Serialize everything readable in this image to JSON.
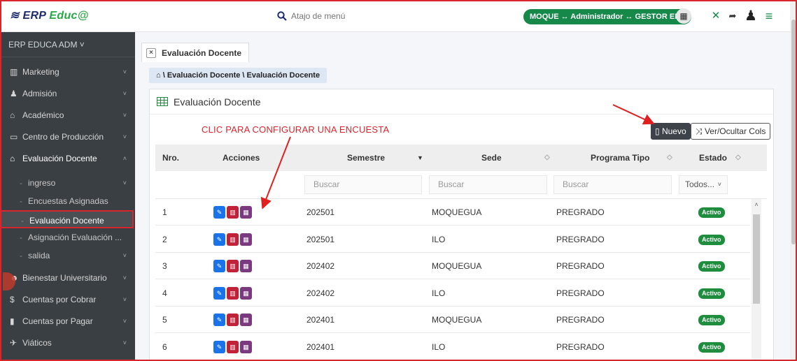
{
  "app": {
    "logo_prefix": "ERP ",
    "logo_suffix": "Educ@",
    "search_placeholder": "Atajo de menú",
    "user_info": "MOQUE ↔ Administrador ↔ GESTOR ERP",
    "brand_color": "#16894a"
  },
  "sidebar": {
    "header": "ERP EDUCA ADM ˅",
    "items": [
      {
        "label": "Marketing",
        "icon": "bar-chart-icon"
      },
      {
        "label": "Admisión",
        "icon": "user-icon"
      },
      {
        "label": "Académico",
        "icon": "graduation-cap-icon"
      },
      {
        "label": "Centro de Producción",
        "icon": "monitor-icon"
      },
      {
        "label": "Evaluación Docente",
        "icon": "graduation-cap-icon"
      }
    ],
    "subitems": [
      {
        "label": "ingreso"
      },
      {
        "label": "Encuestas Asignadas"
      },
      {
        "label": "Evaluación Docente"
      },
      {
        "label": "Asignación Evaluación ..."
      },
      {
        "label": "salida"
      }
    ],
    "items2": [
      {
        "label": "Bienestar Universitario",
        "icon": "users-icon"
      },
      {
        "label": "Cuentas por Cobrar",
        "icon": "dollar-icon"
      },
      {
        "label": "Cuentas por Pagar",
        "icon": "briefcase-icon"
      },
      {
        "label": "Viáticos",
        "icon": "plane-icon"
      }
    ]
  },
  "tabs": [
    {
      "label": "Evaluación Docente"
    }
  ],
  "breadcrumb": "\\ Evaluación Docente \\ Evaluación Docente",
  "card": {
    "title": "Evaluación Docente",
    "annotation": "CLIC PARA CONFIGURAR UNA ENCUESTA",
    "nuevo_label": "Nuevo",
    "cols_label": "Ver/Ocultar Cols"
  },
  "table": {
    "headers": {
      "nro": "Nro.",
      "acciones": "Acciones",
      "semestre": "Semestre",
      "sede": "Sede",
      "programa": "Programa Tipo",
      "estado": "Estado"
    },
    "filters": {
      "semestre": "Buscar",
      "sede": "Buscar",
      "programa": "Buscar",
      "estado": "Todos..."
    },
    "rows": [
      {
        "nro": "1",
        "semestre": "202501",
        "sede": "MOQUEGUA",
        "programa": "PREGRADO",
        "estado": "Activo"
      },
      {
        "nro": "2",
        "semestre": "202501",
        "sede": "ILO",
        "programa": "PREGRADO",
        "estado": "Activo"
      },
      {
        "nro": "3",
        "semestre": "202402",
        "sede": "MOQUEGUA",
        "programa": "PREGRADO",
        "estado": "Activo"
      },
      {
        "nro": "4",
        "semestre": "202402",
        "sede": "ILO",
        "programa": "PREGRADO",
        "estado": "Activo"
      },
      {
        "nro": "5",
        "semestre": "202401",
        "sede": "MOQUEGUA",
        "programa": "PREGRADO",
        "estado": "Activo"
      },
      {
        "nro": "6",
        "semestre": "202401",
        "sede": "ILO",
        "programa": "PREGRADO",
        "estado": "Activo"
      }
    ]
  }
}
